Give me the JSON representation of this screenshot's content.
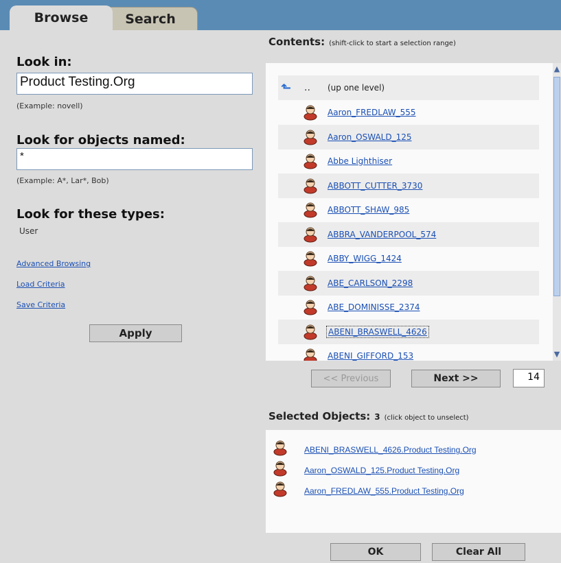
{
  "tabs": {
    "browse": "Browse",
    "search": "Search"
  },
  "left": {
    "look_in_label": "Look in:",
    "look_in_value": "Product Testing.Org",
    "look_in_hint": "(Example: novell)",
    "named_label": "Look for objects named:",
    "named_value": "*",
    "named_hint": "(Example: A*, Lar*, Bob)",
    "types_label": "Look for these types:",
    "types_value": "User",
    "links": [
      "Advanced Browsing",
      "Load Criteria",
      "Save Criteria"
    ],
    "apply_label": "Apply"
  },
  "contents": {
    "title": "Contents:",
    "subtitle": "(shift-click to start a selection range)",
    "up_dots": "..",
    "up_label": "(up one level)",
    "items": [
      "Aaron_FREDLAW_555",
      "Aaron_OSWALD_125",
      "Abbe Lighthiser",
      "ABBOTT_CUTTER_3730",
      "ABBOTT_SHAW_985",
      "ABBRA_VANDERPOOL_574",
      "ABBY_WIGG_1424",
      "ABE_CARLSON_2298",
      "ABE_DOMINISSE_2374",
      "ABENI_BRASWELL_4626",
      "ABENI_GIFFORD_153"
    ],
    "selected_item_index": 9
  },
  "pager": {
    "previous": "<< Previous",
    "next": "Next >>",
    "page": "14"
  },
  "selected": {
    "title": "Selected Objects:",
    "count": "3",
    "subtitle": "(click object to unselect)",
    "items": [
      "ABENI_BRASWELL_4626.Product Testing.Org",
      "Aaron_OSWALD_125.Product Testing.Org",
      "Aaron_FREDLAW_555.Product Testing.Org"
    ]
  },
  "footer": {
    "ok": "OK",
    "clear_all": "Clear All"
  },
  "icons": {
    "up": "up-arrow-icon",
    "user": "user-icon"
  }
}
